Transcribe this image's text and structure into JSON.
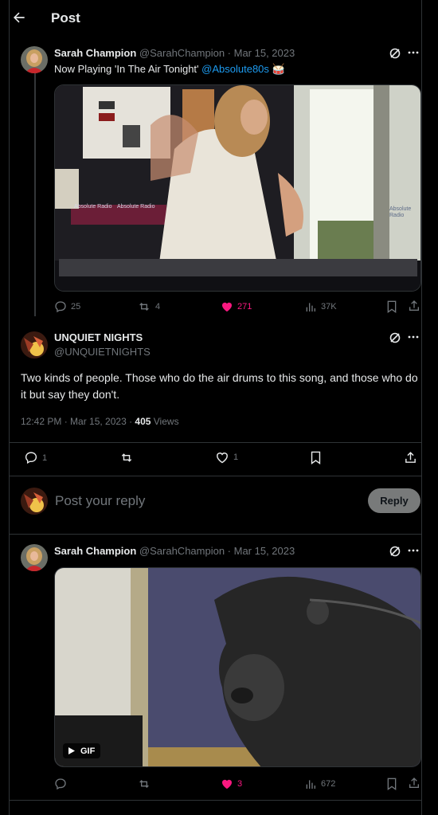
{
  "header": {
    "title": "Post"
  },
  "colors": {
    "accent": "#1d9bf0",
    "like": "#f91880",
    "muted": "#71767b",
    "text": "#e7e9ea"
  },
  "parent_post": {
    "name": "Sarah Champion",
    "handle_date": "@SarahChampion · Mar 15, 2023",
    "text_prefix": "Now Playing 'In The Air Tonight' ",
    "mention": "@Absolute80s",
    "emoji": "🥁",
    "media_labels": [
      "Absolute Radio",
      "Absolute Radio",
      "Absolute Radio"
    ],
    "stats": {
      "replies": "25",
      "reposts": "4",
      "likes": "271",
      "views": "37K"
    }
  },
  "main_post": {
    "name": "UNQUIET NIGHTS",
    "handle": "@UNQUIETNIGHTS",
    "text": "Two kinds of people. Those who do the air drums to this song, and those who do it but say they don't.",
    "time": "12:42 PM · Mar 15, 2023 · ",
    "views_count": "405",
    "views_label": " Views",
    "stats": {
      "replies": "1",
      "likes": "1"
    }
  },
  "reply_box": {
    "placeholder": "Post your reply",
    "button": "Reply"
  },
  "child_post": {
    "name": "Sarah Champion",
    "handle_date": "@SarahChampion · Mar 15, 2023",
    "gif_label": "GIF",
    "stats": {
      "likes": "3",
      "views": "672"
    }
  },
  "icons": [
    "back-arrow-icon",
    "grok-icon",
    "more-icon",
    "reply-icon",
    "repost-icon",
    "like-icon",
    "views-icon",
    "bookmark-icon",
    "share-icon",
    "play-icon"
  ]
}
